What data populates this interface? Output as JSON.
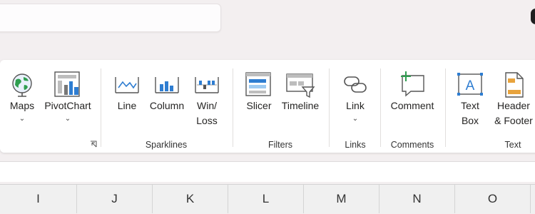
{
  "search": {
    "placeholder": ""
  },
  "ribbon": {
    "groups": [
      {
        "label": "",
        "buttons": [
          {
            "label": "Maps",
            "icon": "globe-maps-icon",
            "has_dropdown": true
          },
          {
            "label": "PivotChart",
            "icon": "pivotchart-icon",
            "has_dropdown": true
          }
        ]
      },
      {
        "label": "Sparklines",
        "buttons": [
          {
            "label": "Line",
            "icon": "sparkline-line-icon"
          },
          {
            "label": "Column",
            "icon": "sparkline-column-icon"
          },
          {
            "label": "Win/",
            "label2": "Loss",
            "icon": "sparkline-winloss-icon"
          }
        ]
      },
      {
        "label": "Filters",
        "buttons": [
          {
            "label": "Slicer",
            "icon": "slicer-icon"
          },
          {
            "label": "Timeline",
            "icon": "timeline-icon"
          }
        ]
      },
      {
        "label": "Links",
        "buttons": [
          {
            "label": "Link",
            "icon": "link-icon",
            "has_dropdown": true
          }
        ]
      },
      {
        "label": "Comments",
        "buttons": [
          {
            "label": "Comment",
            "icon": "comment-icon"
          }
        ]
      },
      {
        "label": "Text",
        "buttons": [
          {
            "label": "Text",
            "label2": "Box",
            "icon": "text-box-icon"
          },
          {
            "label": "Header",
            "label2": "& Footer",
            "icon": "header-footer-icon"
          }
        ]
      }
    ],
    "chevron": "⌄"
  },
  "columns": [
    "I",
    "J",
    "K",
    "L",
    "M",
    "N",
    "O"
  ],
  "colors": {
    "accent_blue": "#2e7dd1",
    "accent_green": "#2e9e4f",
    "accent_orange": "#e8a33d"
  }
}
